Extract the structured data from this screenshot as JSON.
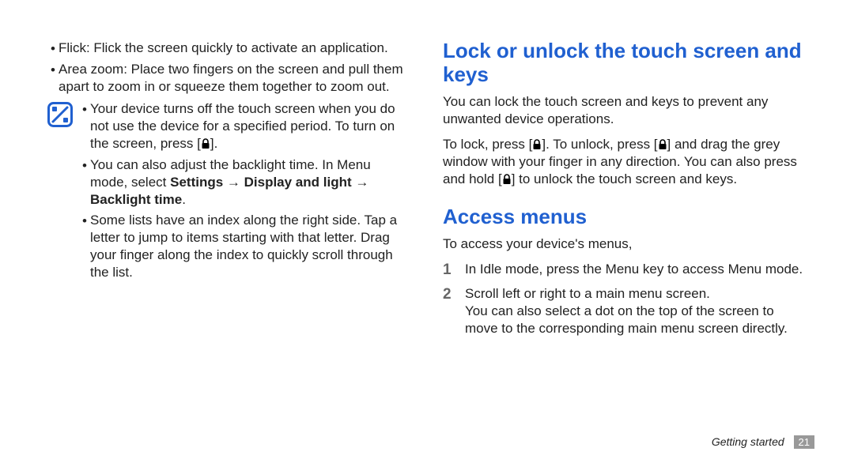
{
  "left": {
    "b1": "Flick: Flick the screen quickly to activate an application.",
    "b2": "Area zoom: Place two fingers on the screen and pull them apart to zoom in or squeeze them together to zoom out.",
    "note": {
      "n1a": "Your device turns off the touch screen when you do not use the device for a specified period. To turn on the screen, press [",
      "n1b": "].",
      "n2a": "You can also adjust the backlight time. In Menu mode, select ",
      "n2bold": "Settings → Display and light → Backlight time",
      "n2b": ".",
      "n3": "Some lists have an index along the right side. Tap a letter to jump to items starting with that letter. Drag your finger along the index to quickly scroll through the list."
    }
  },
  "right": {
    "h1": "Lock or unlock the touch screen and keys",
    "p1": "You can lock the touch screen and keys to prevent any unwanted device operations.",
    "p2a": "To lock, press [",
    "p2b": "]. To unlock, press [",
    "p2c": "] and drag the grey window with your finger in any direction. You can also press and hold [",
    "p2d": "] to unlock the touch screen and keys.",
    "h2": "Access menus",
    "p3": "To access your device's menus,",
    "step1_num": "1",
    "step1": "In Idle mode, press the Menu key to access Menu mode.",
    "step2_num": "2",
    "step2": "Scroll left or right to a main menu screen.",
    "step2_extra": "You can also select a dot on the top of the screen to move to the corresponding main menu screen directly."
  },
  "footer": {
    "label": "Getting started",
    "page": "21"
  }
}
